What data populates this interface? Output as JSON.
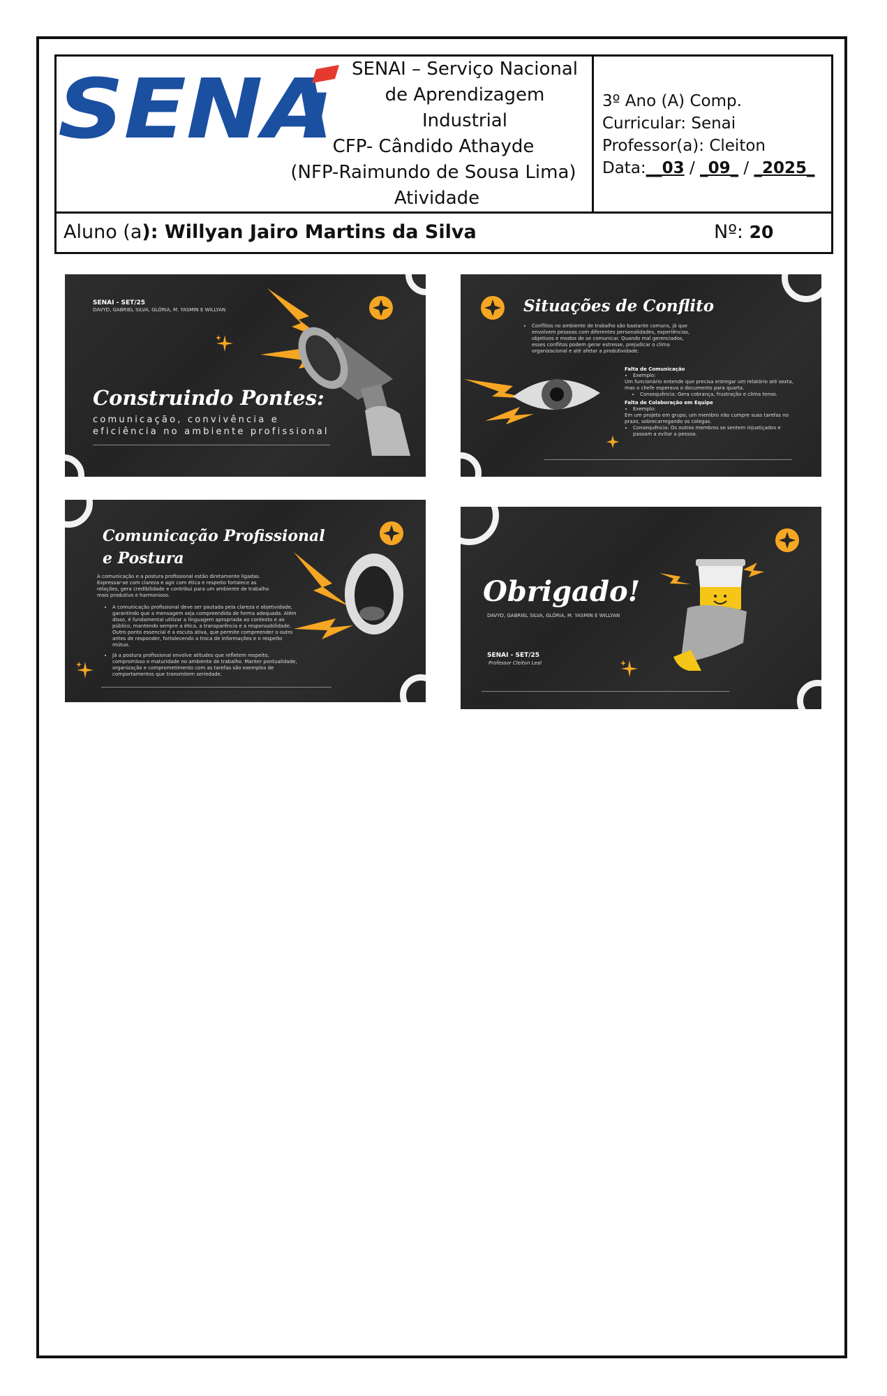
{
  "header": {
    "logo_text": "SENAi",
    "institution_lines": [
      "SENAI – Serviço Nacional",
      "de Aprendizagem",
      "Industrial",
      "CFP- Cândido Athayde",
      "(NFP-Raimundo de Sousa Lima)",
      "Atividade"
    ],
    "year_class": "3º Ano (A) Comp.",
    "curricular": "Curricular: Senai",
    "professor": "Professor(a): Cleiton",
    "date_label": "Data:",
    "date_day": "__03",
    "date_month": "_09_",
    "date_year": "_2025_",
    "date_sep": "/",
    "student_label": "Aluno (a",
    "student_name": "): Willyan Jairo Martins da Silva",
    "number_label": "Nº:",
    "number_value": "20"
  },
  "colors": {
    "accent": "#f5a623",
    "slide_bg": "#262626",
    "logo_blue": "#1b4fa0",
    "logo_red": "#e53a2f"
  },
  "slides": [
    {
      "tag": "SENAI - SET/25",
      "authors": "DAVYD, GABRIEL SILVA, GLÓRIA, M. YASMIN E WILLYAN",
      "title": "Construindo Pontes:",
      "subtitle_1": "comunicação, convivência e",
      "subtitle_2": "eficiência no ambiente profissional",
      "image": "megaphone-hand"
    },
    {
      "title": "Situações de Conflito",
      "intro": "Conflitos no ambiente de trabalho são bastante comuns, já que envolvem pessoas com diferentes personalidades, experiências, objetivos e modos de se comunicar. Quando mal gerenciados, esses conflitos podem gerar estresse, prejudicar o clima organizacional e até afetar a produtividade.",
      "h1": "Falta de Comunicação",
      "ex1_label": "Exemplo:",
      "ex1": "Um funcionário entende que precisa entregar um relatório até sexta, mas o chefe esperava o documento para quarta.",
      "c1": "Consequência: Gera cobrança, frustração e clima tenso.",
      "h2": "Falta de Colaboração em Equipe",
      "ex2_label": "Exemplo:",
      "ex2": "Em um projeto em grupo, um membro não cumpre suas tarefas no prazo, sobrecarregando os colegas.",
      "c2": "Consequência: Os outros membros se sentem injustiçados e passam a evitar a pessoa.",
      "image": "eye"
    },
    {
      "title_1": "Comunicação Profissional",
      "title_2": "e Postura",
      "intro": "A comunicação e a postura profissional estão diretamente ligadas. Expressar-se com clareza e agir com ética e respeito fortalece as relações, gera credibilidade e contribui para um ambiente de trabalho mais produtivo e harmonioso.",
      "b1": "A comunicação profissional deve ser pautada pela clareza e objetividade, garantindo que a mensagem seja compreendida de forma adequada. Além disso, é fundamental utilizar a linguagem apropriada ao contexto e ao público, mantendo sempre a ética, a transparência e a responsabilidade. Outro ponto essencial é a escuta ativa, que permite compreender o outro antes de responder, fortalecendo a troca de informações e o respeito mútuo.",
      "b2": "Já a postura profissional envolve atitudes que refletem respeito, compromisso e maturidade no ambiente de trabalho. Manter pontualidade, organização e comprometimento com as tarefas são exemplos de comportamentos que transmitem seriedade.",
      "image": "shouting-mouth"
    },
    {
      "title": "Obrigado!",
      "authors": "DAVYD, GABRIEL SILVA, GLÓRIA, M. YASMIN E WILLYAN",
      "tag": "SENAI - SET/25",
      "professor": "Professor Cleiton Leal",
      "image": "coffee-cup-hand"
    }
  ]
}
